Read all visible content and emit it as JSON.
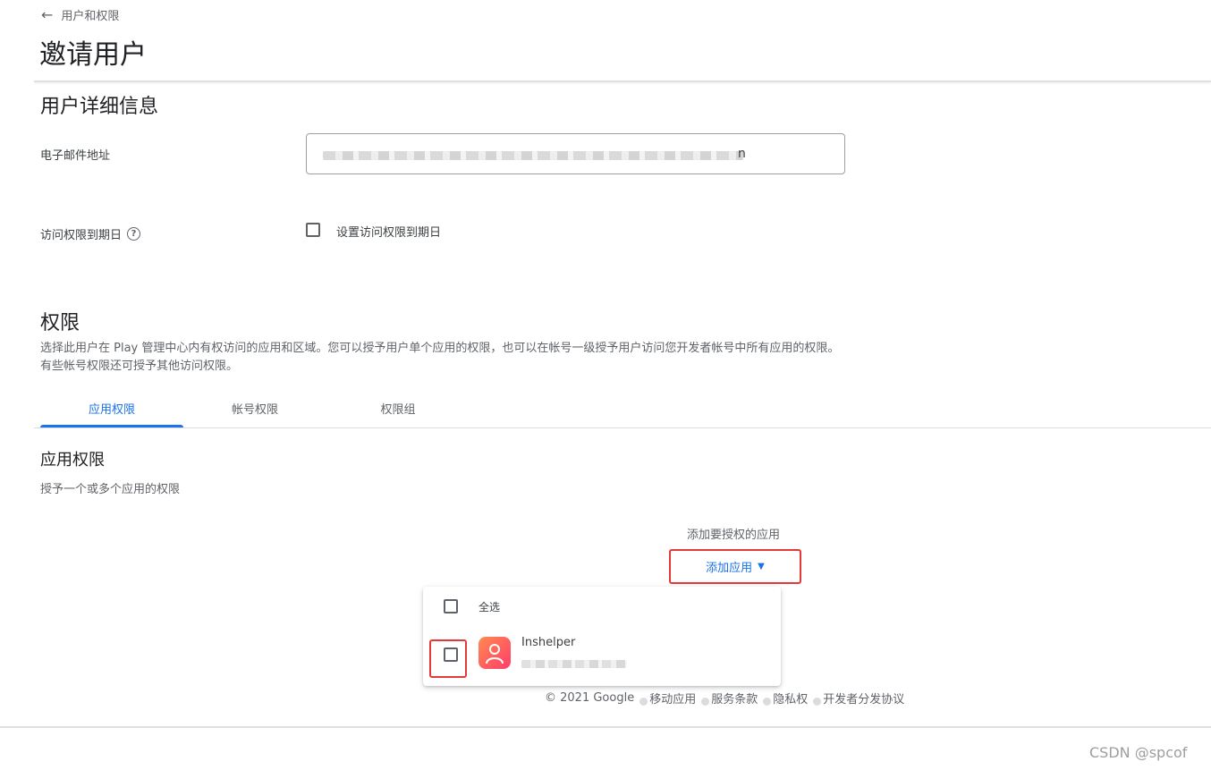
{
  "header": {
    "back_label": "用户和权限",
    "title": "邀请用户"
  },
  "user_details": {
    "title": "用户详细信息",
    "email_label": "电子邮件地址",
    "email_value_visible_tail": "n",
    "expiry_label": "访问权限到期日",
    "expiry_checkbox_label": "设置访问权限到期日"
  },
  "permissions": {
    "title": "权限",
    "description": "选择此用户在 Play 管理中心内有权访问的应用和区域。您可以授予用户单个应用的权限，也可以在帐号一级授予用户访问您开发者帐号中所有应用的权限。有些帐号权限还可授予其他访问权限。",
    "tabs": [
      {
        "label": "应用权限",
        "active": true
      },
      {
        "label": "帐号权限",
        "active": false
      },
      {
        "label": "权限组",
        "active": false
      }
    ]
  },
  "app_permissions": {
    "title": "应用权限",
    "description": "授予一个或多个应用的权限",
    "add_label": "添加要授权的应用",
    "add_button_label": "添加应用"
  },
  "dropdown": {
    "select_all_label": "全选",
    "items": [
      {
        "name": "Inshelper"
      }
    ]
  },
  "footer": {
    "copyright": "© 2021 Google",
    "links": [
      "移动应用",
      "服务条款",
      "隐私权",
      "开发者分发协议"
    ]
  },
  "watermark": "CSDN @spcof",
  "colors": {
    "accent": "#1a73e8",
    "highlight": "#e53935"
  }
}
